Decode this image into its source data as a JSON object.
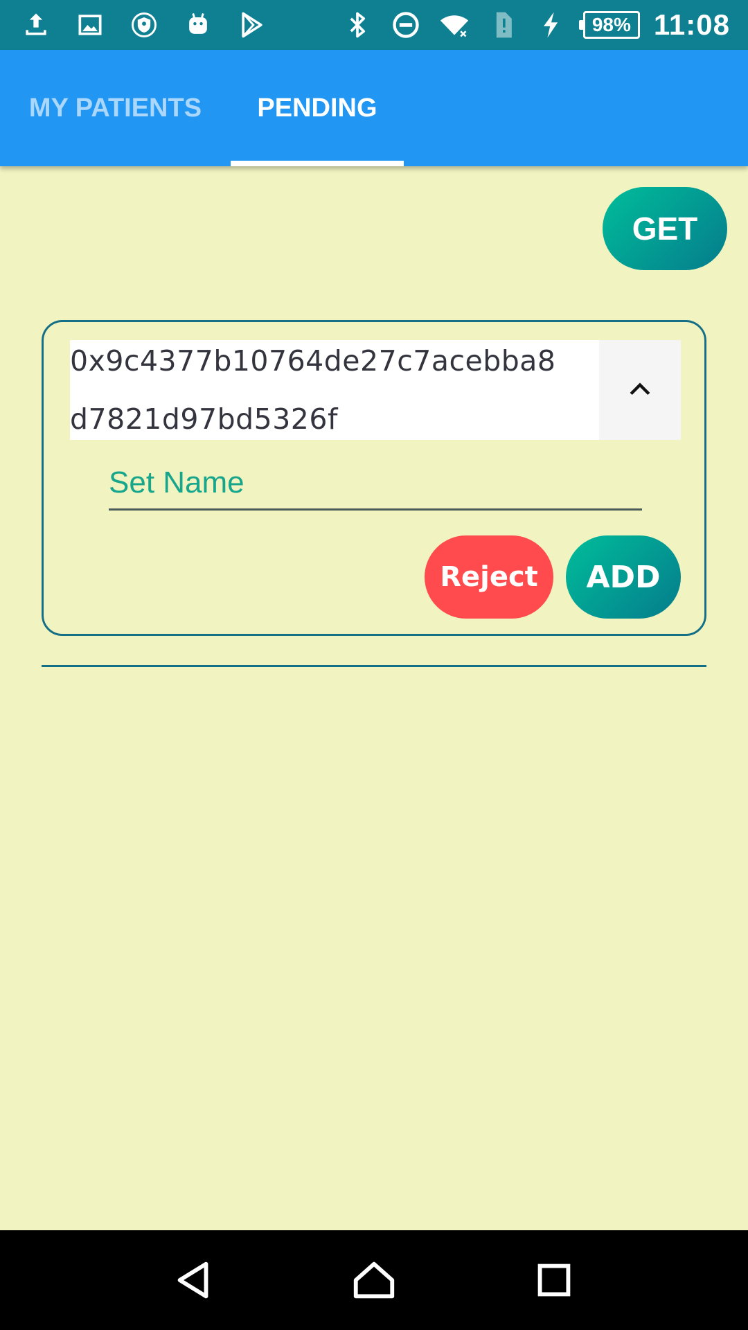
{
  "status_bar": {
    "battery_text": "98%",
    "time": "11:08",
    "left_icons": [
      "upload-icon",
      "image-icon",
      "vpn-shield-icon",
      "android-icon",
      "play-store-icon"
    ],
    "right_icons": [
      "bluetooth-icon",
      "do-not-disturb-icon",
      "wifi-icon",
      "sim-alert-icon",
      "charging-icon"
    ]
  },
  "tabs": [
    {
      "label": "MY PATIENTS",
      "selected": false
    },
    {
      "label": "PENDING",
      "selected": true
    }
  ],
  "get_button": {
    "label": "GET"
  },
  "pending_request": {
    "address_line_1": "0x9c4377b10764de27c7acebba8",
    "address_line_2": "d7821d97bd5326f",
    "toggle_icon": "chevron-up-icon",
    "name_placeholder": "Set Name",
    "reject_label": "Reject",
    "add_label": "ADD"
  },
  "nav_bar": {
    "icons": [
      "back-icon",
      "home-icon",
      "recents-icon"
    ]
  },
  "colors": {
    "status_bar": "#0e8091",
    "tab_bar": "#2196f3",
    "background": "#f1f3c1",
    "accent_teal": "#00bd9a",
    "reject_red": "#ff4b4d",
    "card_border": "#156f86"
  }
}
